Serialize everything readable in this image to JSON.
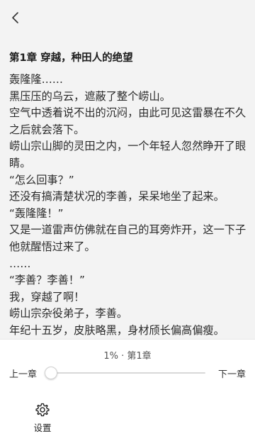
{
  "header": {
    "back_icon": "chevron-left-icon"
  },
  "chapter": {
    "title": "第1章 穿越，种田人的绝望",
    "paragraphs": [
      "轰隆隆……",
      "黑压压的乌云，遮蔽了整个崂山。",
      "空气中透着说不出的沉闷，由此可见这雷暴在不久之后就会落下。",
      "崂山宗山脚的灵田之内，一个年轻人忽然睁开了眼睛。",
      "“怎么回事？”",
      "还没有搞清楚状况的李善，呆呆地坐了起来。",
      "“轰隆隆！”",
      "又是一道雷声仿佛就在自己的耳旁炸开，这一下子他就醒悟过来了。",
      "……",
      "“李善？李善！”",
      "我，穿越了啊！",
      "崂山宗杂役弟子，李善。",
      "年纪十五岁，皮肤略黑，身材颀长偏高偏瘦。"
    ]
  },
  "reader_controls": {
    "progress_text": "1% · 第1章",
    "progress_fraction": 0.0,
    "prev_label": "上一章",
    "next_label": "下一章",
    "settings_label": "设置",
    "settings_icon": "gear-icon"
  }
}
